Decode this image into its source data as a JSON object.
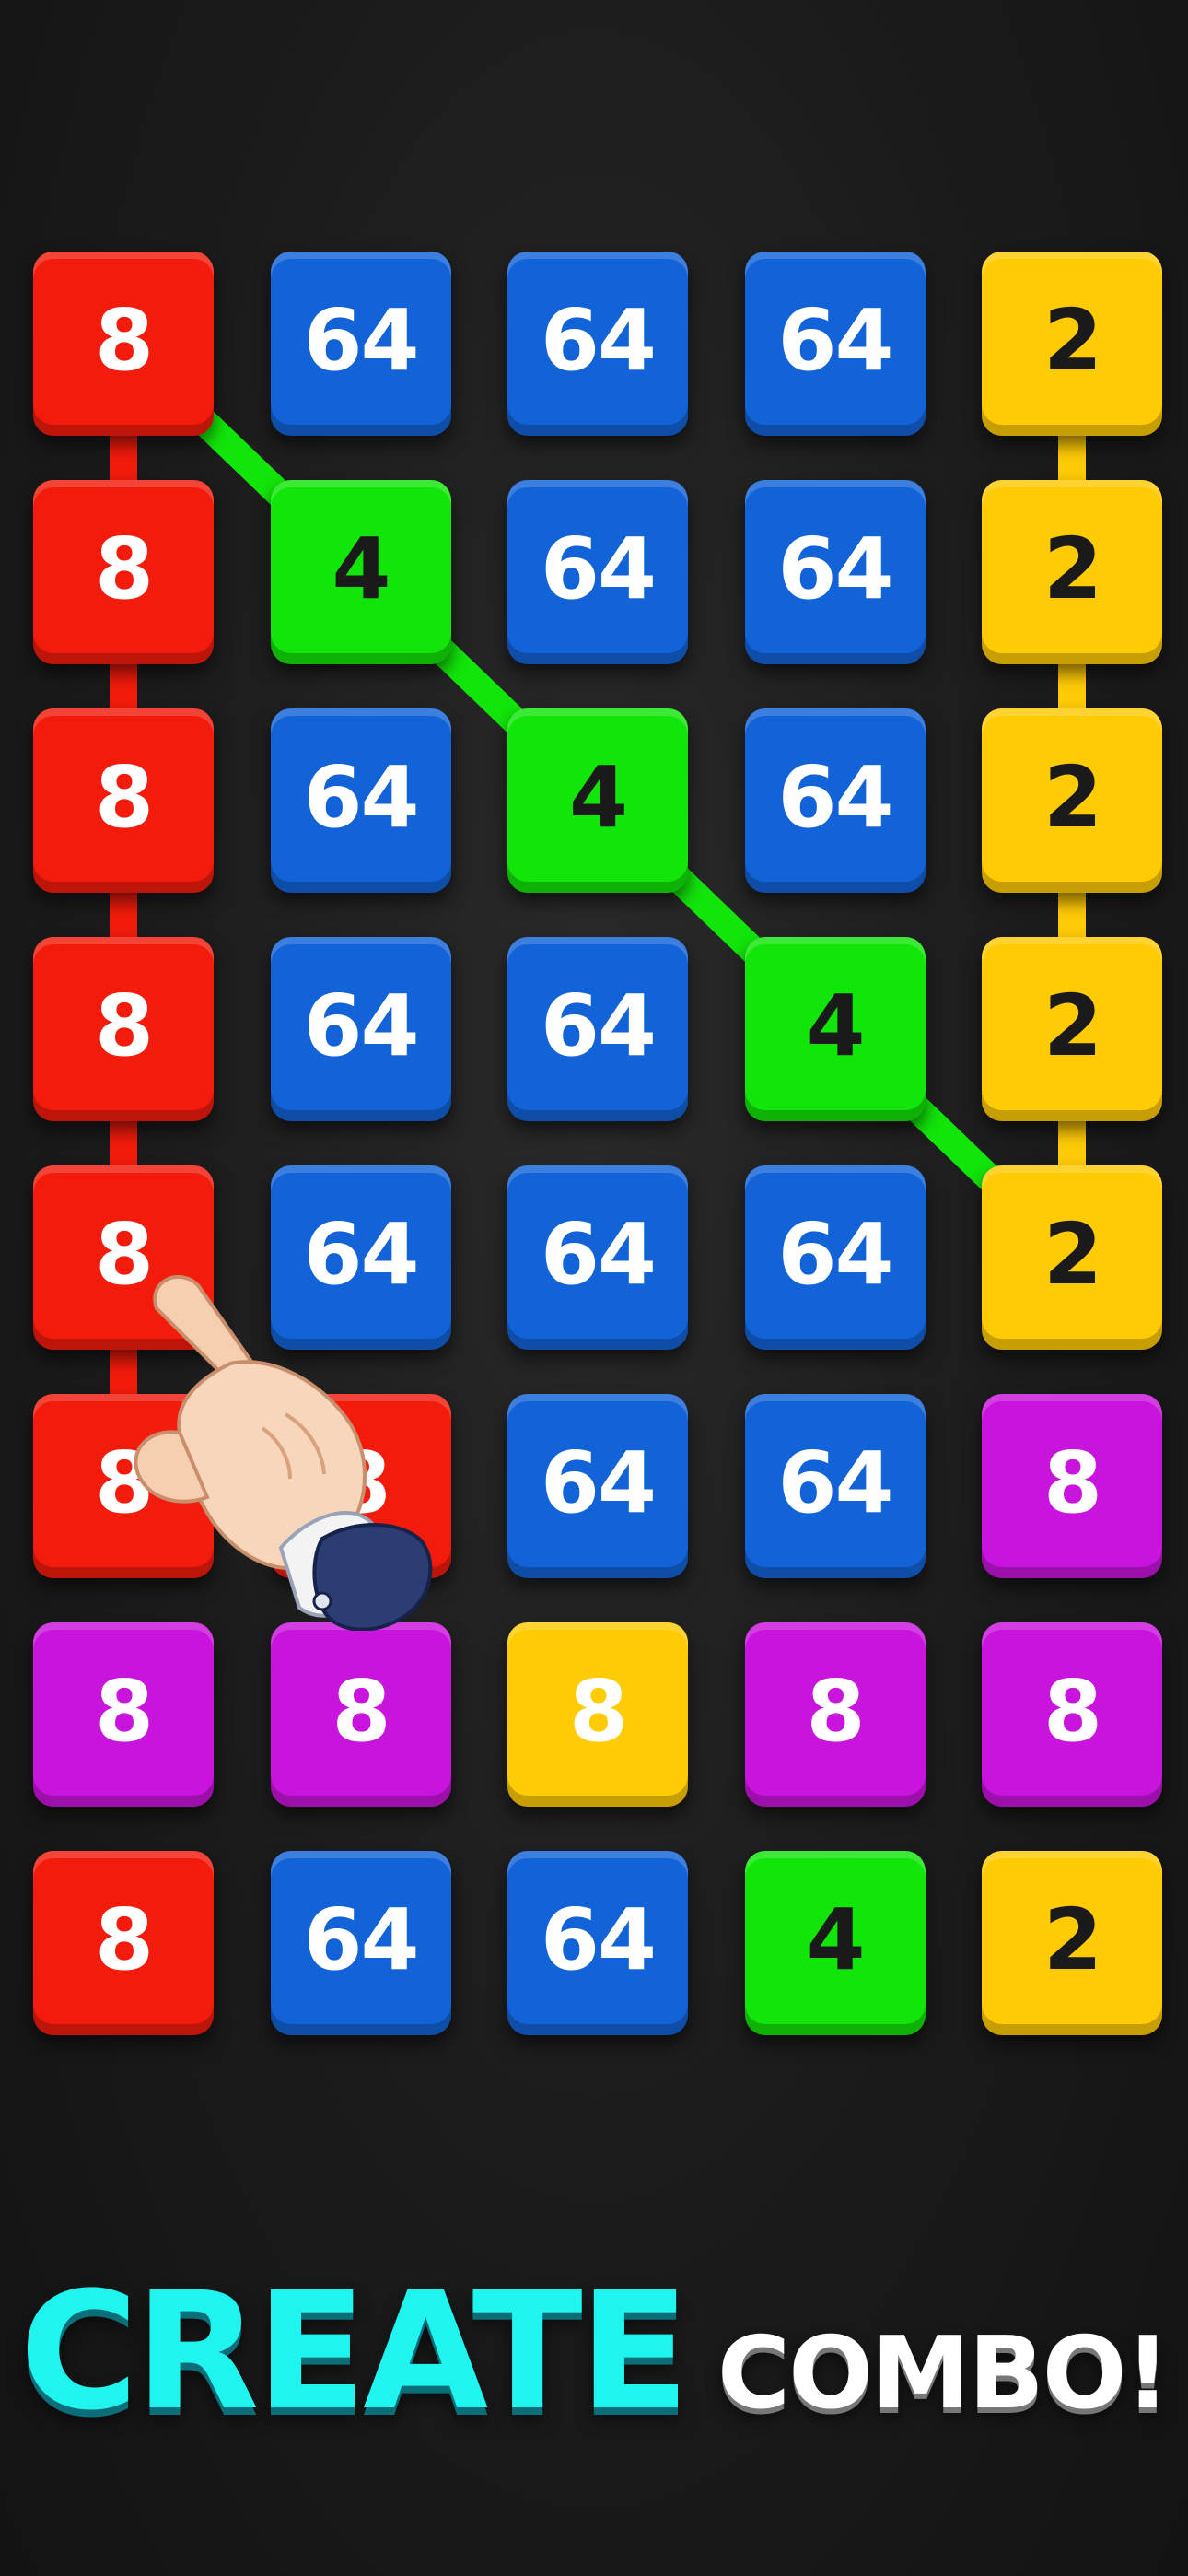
{
  "board": {
    "rows": [
      [
        {
          "v": "8",
          "c": "red"
        },
        {
          "v": "64",
          "c": "blue"
        },
        {
          "v": "64",
          "c": "blue"
        },
        {
          "v": "64",
          "c": "blue"
        },
        {
          "v": "2",
          "c": "yellow"
        }
      ],
      [
        {
          "v": "8",
          "c": "red"
        },
        {
          "v": "4",
          "c": "green"
        },
        {
          "v": "64",
          "c": "blue"
        },
        {
          "v": "64",
          "c": "blue"
        },
        {
          "v": "2",
          "c": "yellow"
        }
      ],
      [
        {
          "v": "8",
          "c": "red"
        },
        {
          "v": "64",
          "c": "blue"
        },
        {
          "v": "4",
          "c": "green"
        },
        {
          "v": "64",
          "c": "blue"
        },
        {
          "v": "2",
          "c": "yellow"
        }
      ],
      [
        {
          "v": "8",
          "c": "red"
        },
        {
          "v": "64",
          "c": "blue"
        },
        {
          "v": "64",
          "c": "blue"
        },
        {
          "v": "4",
          "c": "green"
        },
        {
          "v": "2",
          "c": "yellow"
        }
      ],
      [
        {
          "v": "8",
          "c": "red"
        },
        {
          "v": "64",
          "c": "blue"
        },
        {
          "v": "64",
          "c": "blue"
        },
        {
          "v": "64",
          "c": "blue"
        },
        {
          "v": "2",
          "c": "yellow"
        }
      ],
      [
        {
          "v": "8",
          "c": "red"
        },
        {
          "v": "8",
          "c": "red"
        },
        {
          "v": "64",
          "c": "blue"
        },
        {
          "v": "64",
          "c": "blue"
        },
        {
          "v": "8",
          "c": "purple"
        }
      ],
      [
        {
          "v": "8",
          "c": "purple"
        },
        {
          "v": "8",
          "c": "purple"
        },
        {
          "v": "8",
          "c": "yellow"
        },
        {
          "v": "8",
          "c": "purple"
        },
        {
          "v": "8",
          "c": "purple"
        }
      ],
      [
        {
          "v": "8",
          "c": "red"
        },
        {
          "v": "64",
          "c": "blue"
        },
        {
          "v": "64",
          "c": "blue"
        },
        {
          "v": "4",
          "c": "green"
        },
        {
          "v": "2",
          "c": "yellow"
        }
      ]
    ],
    "chains": [
      {
        "color": "#f21b0c",
        "cells": [
          [
            0,
            0
          ],
          [
            1,
            0
          ],
          [
            2,
            0
          ],
          [
            3,
            0
          ],
          [
            4,
            0
          ],
          [
            5,
            0
          ]
        ]
      },
      {
        "color": "#12e50a",
        "cells": [
          [
            0,
            0
          ],
          [
            1,
            1
          ],
          [
            2,
            2
          ],
          [
            3,
            3
          ],
          [
            4,
            4
          ]
        ]
      },
      {
        "color": "#ffcb05",
        "cells": [
          [
            0,
            4
          ],
          [
            1,
            4
          ],
          [
            2,
            4
          ],
          [
            3,
            4
          ],
          [
            4,
            4
          ]
        ]
      }
    ]
  },
  "colors": {
    "red": "#f21b0c",
    "blue": "#1363d8",
    "yellow": "#ffcb05",
    "green": "#12e50a",
    "purple": "#c814dc"
  },
  "hand": {
    "icon": "pointing-hand-icon"
  },
  "tagline": {
    "word1": "CREATE",
    "word2": "COMBO!"
  }
}
